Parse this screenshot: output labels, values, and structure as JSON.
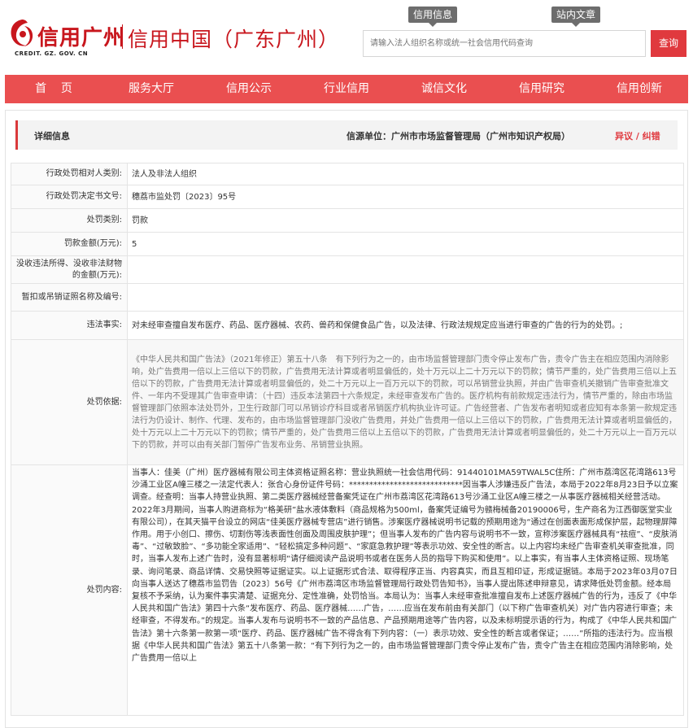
{
  "header": {
    "logo_text": "信用广州",
    "logo_en": "CREDIT. GZ. GOV. CN",
    "site_name": "信用中国（广东广州）",
    "top_links": [
      "信用信息",
      "站内文章"
    ],
    "search": {
      "placeholder": "请输入法人组织名称或统一社会信用代码查询",
      "button_label": "查询"
    }
  },
  "nav": {
    "items": [
      "首    页",
      "服务大厅",
      "信用公示",
      "行业信用",
      "诚信文化",
      "信用研究",
      "信用创新"
    ]
  },
  "panel": {
    "title": "详细信息",
    "source": "信源单位：广州市市场监督管理局（广州市知识产权局）",
    "feedback_link": "异议 / 纠错"
  },
  "rows": [
    {
      "label": "行政处罚相对人类别:",
      "value": "法人及非法人组织"
    },
    {
      "label": "行政处罚决定书文号:",
      "value": "穗荔市监处罚〔2023〕95号"
    },
    {
      "label": "处罚类别:",
      "value": "罚款"
    },
    {
      "label": "罚款金额(万元):",
      "value": "5"
    },
    {
      "label": "没收违法所得、没收非法财物的金额(万元):",
      "value": ""
    },
    {
      "label": "暂扣或吊销证照名称及编号:",
      "value": ""
    },
    {
      "label": "违法事实:",
      "value": "对未经审查擅自发布医疗、药品、医疗器械、农药、兽药和保健食品广告，以及法律、行政法规规定应当进行审查的广告的行为的处罚。;"
    },
    {
      "label": "处罚依据:",
      "value": "《中华人民共和国广告法》（2021年修正）第五十八条　有下列行为之一的，由市场监督管理部门责令停止发布广告，责令广告主在相应范围内消除影响，处广告费用一倍以上三倍以下的罚款，广告费用无法计算或者明显偏低的，处十万元以上二十万元以下的罚款；情节严重的，处广告费用三倍以上五倍以下的罚款，广告费用无法计算或者明显偏低的，处二十万元以上一百万元以下的罚款，可以吊销营业执照，并由广告审查机关撤销广告审查批准文件、一年内不受理其广告审查申请：（十四）违反本法第四十六条规定，未经审查发布广告的。医疗机构有前款规定违法行为，情节严重的，除由市场监督管理部门依照本法处罚外，卫生行政部门可以吊销诊疗科目或者吊销医疗机构执业许可证。广告经营者、广告发布者明知或者应知有本条第一款规定违法行为仍设计、制作、代理、发布的，由市场监督管理部门没收广告费用，并处广告费用一倍以上三倍以下的罚款，广告费用无法计算或者明显偏低的，处十万元以上二十万元以下的罚款；情节严重的，处广告费用三倍以上五倍以下的罚款，广告费用无法计算或者明显偏低的，处二十万元以上一百万元以下的罚款，并可以由有关部门暂停广告发布业务、吊销营业执照。"
    },
    {
      "label": "处罚内容:",
      "value": "当事人：佳美（广州）医疗器械有限公司主体资格证照名称：营业执照统一社会信用代码：91440101MA59TWAL5C住所：广州市荔湾区花湾路613号沙涌工业区A幢三楼之一法定代表人：张合心身份证件号码：****************************因当事人涉嫌违反广告法，本局于2022年8月23日予以立案调查。经查明：当事人持营业执照、第二类医疗器械经营备案凭证在广州市荔湾区花湾路613号沙涌工业区A幢三楼之一从事医疗器械相关经营活动。2022年3月期间，当事人购进商标为“格美研”盐水液体敷料（商品规格为500ml，备案凭证编号为赣梅械备20190006号，生产商名为江西御医堂实业有限公司），在其天猫平台设立的网店“佳美医疗器械专营店”进行销售。涉案医疗器械说明书记载的预期用途为“通过在创面表面形成保护层，起物理屏障作用。用于小创口、擦伤、切割伤等浅表面性创面及周围皮肤护理”；但当事人发布的广告内容与说明书不一致，宣称涉案医疗器械具有“祛痘”、“皮肤消毒”、“过敏致脸”、“多功能全家适用”、“轻松搞定多种问题”、“家庭急救护理”等表示功效、安全性的断言。以上内容均未经广告审查机关审查批准，同时，当事人发布上述广告时，没有显著标明“请仔细阅读产品说明书或者在医务人员的指导下购买和使用”。以上事实，有当事人主体资格证照、现场笔录、询问笔录、商品详情、交易快照等证据证实。以上证据形式合法、取得程序正当、内容真实，而且互相印证，形成证据链。本局于2023年03月07日向当事人送达了穗荔市监罚告〔2023〕56号《广州市荔湾区市场监督管理局行政处罚告知书》，当事人提出陈述申辩意见，请求降低处罚金额。经本局复核不予采纳，认为案件事实清楚、证据充分、定性准确，处罚恰当。本局认为：当事人未经审查批准擅自发布上述医疗器械广告的行为，违反了《中华人民共和国广告法》第四十六条“发布医疗、药品、医疗器械……广告，……应当在发布前由有关部门（以下称广告审查机关）对广告内容进行审查；未经审查，不得发布。”的规定。当事人发布与说明书不一致的产品信息、产品预期用途等广告内容，以及未标明提示语的行为，构成了《中华人民共和国广告法》第十六条第一款第一项“医疗、药品、医疗器械广告不得含有下列内容：（一）表示功效、安全性的断言或者保证；……”所指的违法行为。应当根据《中华人民共和国广告法》第五十八条第一款：“有下列行为之一的，由市场监督管理部门责令停止发布广告，责令广告主在相应范围内消除影响，处广告费用一倍以上"
    }
  ]
}
